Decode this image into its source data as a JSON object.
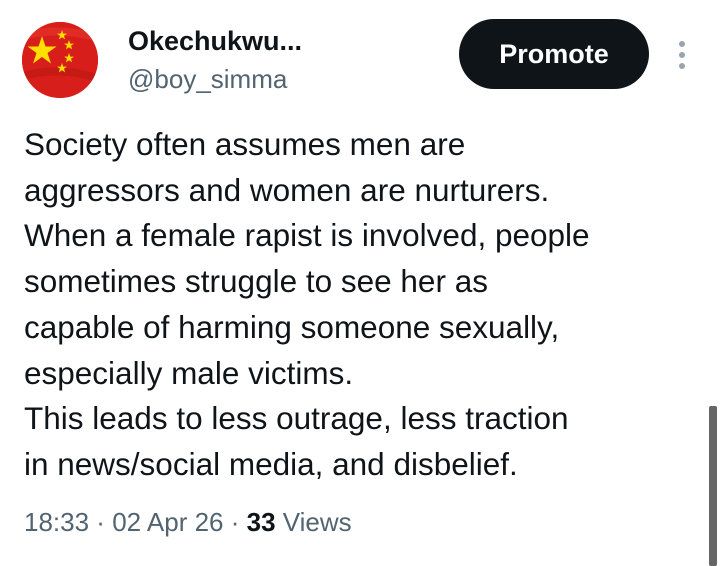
{
  "author": {
    "display_name": "Okechukwu...",
    "handle": "@boy_simma",
    "avatar_icon": "china-flag-avatar"
  },
  "header": {
    "promote_label": "Promote",
    "more_icon": "more-vertical-icon"
  },
  "tweet": {
    "lines": [
      "Society often assumes men are",
      "aggressors and women are nurturers.",
      "When a female rapist is involved, people",
      "sometimes struggle to see her as",
      "capable of harming someone sexually,",
      "especially male victims.",
      "This leads to less outrage, less traction",
      "in news/social media, and disbelief."
    ]
  },
  "meta": {
    "time": "18:33",
    "separator": " · ",
    "date": "02 Apr 26",
    "views_count": "33",
    "views_label": "Views"
  },
  "colors": {
    "text_primary": "#0f1419",
    "text_secondary": "#536471",
    "button_bg": "#0f1419",
    "flag_red": "#d81e1a",
    "flag_yellow": "#ffde00"
  }
}
